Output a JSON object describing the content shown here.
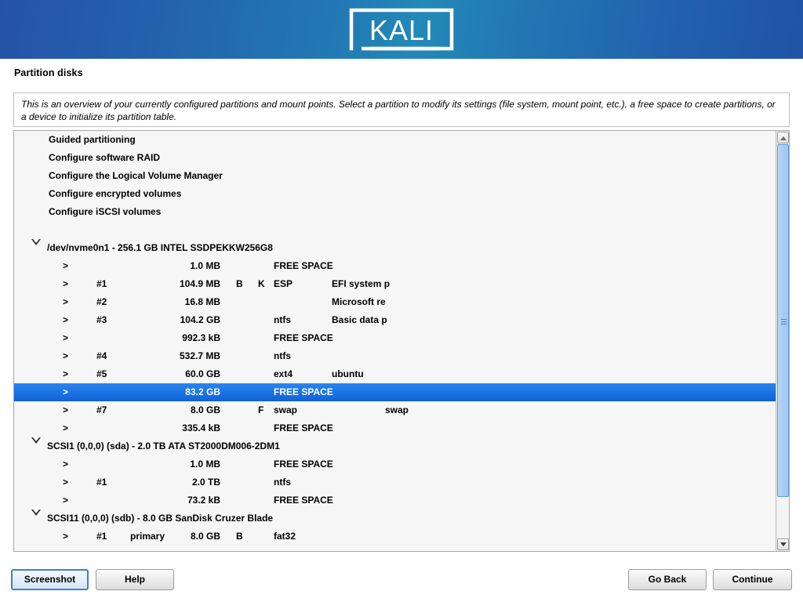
{
  "banner": {
    "logo_text": "KALI",
    "logo_name": "kali-logo"
  },
  "page": {
    "title": "Partition disks",
    "description": "This is an overview of your currently configured partitions and mount points. Select a partition to modify its settings (file system, mount point, etc.), a free space to create partitions, or a device to initialize its partition table."
  },
  "colors": {
    "banner_left": "#2553a8",
    "banner_center": "#2289b8",
    "banner_right": "#2053a6",
    "selection": "#1a73e8",
    "panel_bg": "#f6f6f6",
    "panel_border": "#a9a9a9",
    "focus_border": "#3b7fd4"
  },
  "list": {
    "menu_items": [
      {
        "label": "Guided partitioning"
      },
      {
        "label": "Configure software RAID"
      },
      {
        "label": "Configure the Logical Volume Manager"
      },
      {
        "label": "Configure encrypted volumes"
      },
      {
        "label": "Configure iSCSI volumes"
      }
    ],
    "rows": [
      {
        "kind": "disk",
        "disk": "/dev/nvme0n1 - 256.1 GB INTEL SSDPEKKW256G8",
        "expander": "triangle-down"
      },
      {
        "kind": "part",
        "gt": ">",
        "num": "",
        "ptype": "",
        "size": "1.0 MB",
        "flag_b": "",
        "flag_k": "",
        "flag_f": "",
        "fs": "FREE SPACE",
        "label": "",
        "mount": ""
      },
      {
        "kind": "part",
        "gt": ">",
        "num": "#1",
        "ptype": "",
        "size": "104.9 MB",
        "flag_b": "B",
        "flag_k": "K",
        "flag_f": "",
        "fs": "ESP",
        "label": "EFI system p",
        "mount": ""
      },
      {
        "kind": "part",
        "gt": ">",
        "num": "#2",
        "ptype": "",
        "size": "16.8 MB",
        "flag_b": "",
        "flag_k": "",
        "flag_f": "",
        "fs": "",
        "label": "Microsoft re",
        "mount": ""
      },
      {
        "kind": "part",
        "gt": ">",
        "num": "#3",
        "ptype": "",
        "size": "104.2 GB",
        "flag_b": "",
        "flag_k": "",
        "flag_f": "",
        "fs": "ntfs",
        "label": "Basic data p",
        "mount": ""
      },
      {
        "kind": "part",
        "gt": ">",
        "num": "",
        "ptype": "",
        "size": "992.3 kB",
        "flag_b": "",
        "flag_k": "",
        "flag_f": "",
        "fs": "FREE SPACE",
        "label": "",
        "mount": ""
      },
      {
        "kind": "part",
        "gt": ">",
        "num": "#4",
        "ptype": "",
        "size": "532.7 MB",
        "flag_b": "",
        "flag_k": "",
        "flag_f": "",
        "fs": "ntfs",
        "label": "",
        "mount": ""
      },
      {
        "kind": "part",
        "gt": ">",
        "num": "#5",
        "ptype": "",
        "size": "60.0 GB",
        "flag_b": "",
        "flag_k": "",
        "flag_f": "",
        "fs": "ext4",
        "label": "ubuntu",
        "mount": ""
      },
      {
        "kind": "part",
        "gt": ">",
        "num": "",
        "ptype": "",
        "size": "83.2 GB",
        "flag_b": "",
        "flag_k": "",
        "flag_f": "",
        "fs": "FREE SPACE",
        "label": "",
        "mount": "",
        "selected": true
      },
      {
        "kind": "part",
        "gt": ">",
        "num": "#7",
        "ptype": "",
        "size": "8.0 GB",
        "flag_b": "",
        "flag_k": "",
        "flag_f": "F",
        "fs": "swap",
        "label": "",
        "mount": "swap"
      },
      {
        "kind": "part",
        "gt": ">",
        "num": "",
        "ptype": "",
        "size": "335.4 kB",
        "flag_b": "",
        "flag_k": "",
        "flag_f": "",
        "fs": "FREE SPACE",
        "label": "",
        "mount": ""
      },
      {
        "kind": "disk",
        "disk": "SCSI1 (0,0,0) (sda) - 2.0 TB ATA ST2000DM006-2DM1",
        "expander": "triangle-down"
      },
      {
        "kind": "part",
        "gt": ">",
        "num": "",
        "ptype": "",
        "size": "1.0 MB",
        "flag_b": "",
        "flag_k": "",
        "flag_f": "",
        "fs": "FREE SPACE",
        "label": "",
        "mount": ""
      },
      {
        "kind": "part",
        "gt": ">",
        "num": "#1",
        "ptype": "",
        "size": "2.0 TB",
        "flag_b": "",
        "flag_k": "",
        "flag_f": "",
        "fs": "ntfs",
        "label": "",
        "mount": ""
      },
      {
        "kind": "part",
        "gt": ">",
        "num": "",
        "ptype": "",
        "size": "73.2 kB",
        "flag_b": "",
        "flag_k": "",
        "flag_f": "",
        "fs": "FREE SPACE",
        "label": "",
        "mount": ""
      },
      {
        "kind": "disk",
        "disk": "SCSI11 (0,0,0) (sdb) - 8.0 GB SanDisk Cruzer Blade",
        "expander": "triangle-down"
      },
      {
        "kind": "part",
        "gt": ">",
        "num": "#1",
        "ptype": "primary",
        "size": "8.0 GB",
        "flag_b": "B",
        "flag_k": "",
        "flag_f": "",
        "fs": "fat32",
        "label": "",
        "mount": ""
      }
    ]
  },
  "scrollbar": {
    "up_icon": "chevron-up-icon",
    "down_icon": "chevron-down-icon"
  },
  "buttons": {
    "screenshot": "Screenshot",
    "help": "Help",
    "go_back": "Go Back",
    "continue": "Continue"
  }
}
